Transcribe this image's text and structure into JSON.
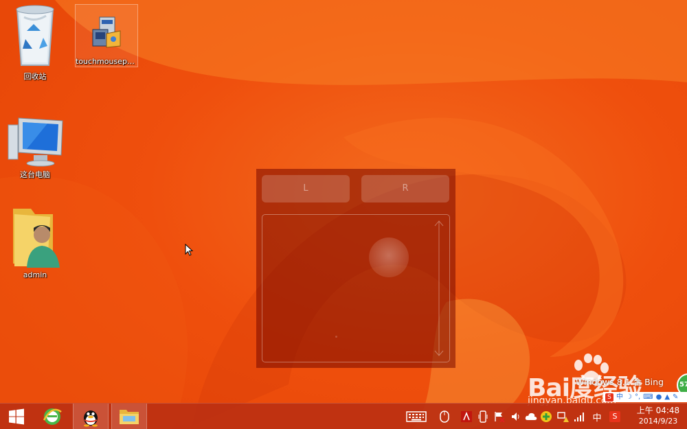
{
  "desktop": {
    "icons": [
      {
        "label": "回收站",
        "icon": "recycle-bin-icon"
      },
      {
        "label": "touchmousepo...",
        "icon": "installer-icon"
      },
      {
        "label": "这台电脑",
        "icon": "computer-icon"
      },
      {
        "label": "admin",
        "icon": "user-folder-icon"
      }
    ],
    "build_text": "Windows 8.1 合 Bing"
  },
  "touchpad": {
    "left_label": "L",
    "right_label": "R"
  },
  "watermark": {
    "brand": "Bai度经验",
    "url": "jingyan.baidu.com"
  },
  "badge": {
    "text": "57"
  },
  "ime_bar": {
    "mode": "中",
    "items": [
      "moon-icon",
      "dot-icon",
      "keyboard-icon",
      "user-icon",
      "shirt-icon",
      "wrench-icon"
    ]
  },
  "taskbar": {
    "apps": [
      "start-icon",
      "ie-icon",
      "qq-icon",
      "file-explorer-icon"
    ],
    "tray": [
      "keyboard-icon",
      "mouse-icon",
      "adobe-icon",
      "phone-icon",
      "flag-icon",
      "volume-icon",
      "cloud-icon",
      "security-icon",
      "network-icon",
      "signal-icon"
    ],
    "ime_label": "中",
    "sogou_label": "S",
    "clock_time": "上午 04:48",
    "clock_date": "2014/9/23"
  },
  "colors": {
    "wallpaper": "#f0520f",
    "taskbar": "#bc3012",
    "touchpad": "#780a00"
  }
}
